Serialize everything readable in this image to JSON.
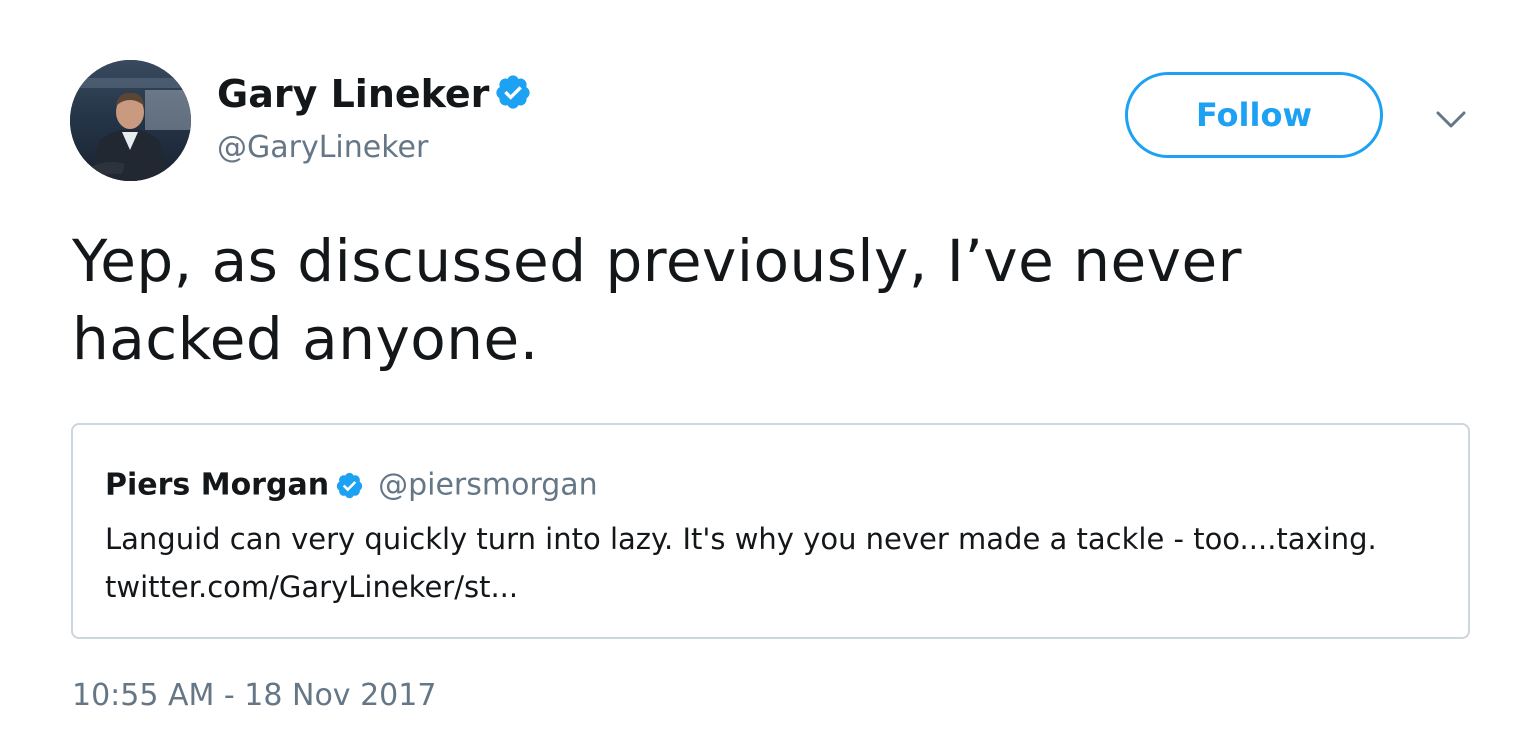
{
  "author": {
    "display_name": "Gary Lineker",
    "handle": "@GaryLineker",
    "verified": true,
    "avatar_icon": "profile-photo"
  },
  "actions": {
    "follow_label": "Follow",
    "menu_icon": "chevron-down-icon"
  },
  "tweet": {
    "text_line1": "Yep, as discussed previously, I’ve never",
    "text_line2": "hacked anyone.",
    "timestamp": "10:55 AM - 18 Nov 2017"
  },
  "quoted_tweet": {
    "display_name": "Piers Morgan",
    "handle": "@piersmorgan",
    "verified": true,
    "text_line1": "Languid can very quickly turn into lazy. It's why you never made a tackle - too....taxing.",
    "text_line2": "twitter.com/GaryLineker/st..."
  },
  "colors": {
    "accent": "#1da1f2",
    "text_primary": "#14171a",
    "text_secondary": "#657786",
    "border": "#ccd6dd"
  }
}
